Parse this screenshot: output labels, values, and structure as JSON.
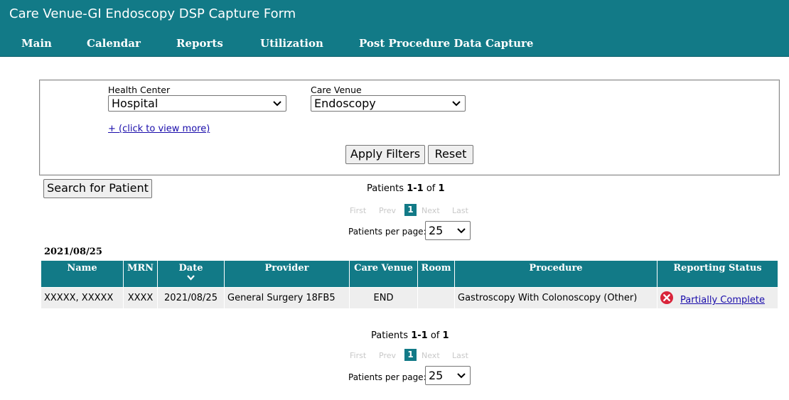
{
  "app": {
    "title": "Care Venue-GI Endoscopy DSP Capture Form"
  },
  "nav": [
    "Main",
    "Calendar",
    "Reports",
    "Utilization",
    "Post Procedure Data Capture"
  ],
  "filters": {
    "health_center_label": "Health Center",
    "health_center_value": "Hospital",
    "care_venue_label": "Care Venue",
    "care_venue_value": "Endoscopy",
    "view_more": "+ (click to view more)",
    "apply_label": "Apply Filters",
    "reset_label": "Reset"
  },
  "search_button": "Search for Patient",
  "pager": {
    "prefix": "Patients",
    "range": "1-1",
    "of": "of",
    "total": "1",
    "first": "First",
    "prev": "Prev",
    "current": "1",
    "next": "Next",
    "last": "Last",
    "per_page_label": "Patients per page:",
    "per_page": "25"
  },
  "group_date": "2021/08/25",
  "table": {
    "headers": [
      "Name",
      "MRN",
      "Date",
      "Provider",
      "Care Venue",
      "Room",
      "Procedure",
      "Reporting Status"
    ],
    "rows": [
      {
        "name": "XXXXX, XXXXX",
        "mrn": "XXXX",
        "date": "2021/08/25",
        "provider": "General Surgery 18FB5",
        "care_venue": "END",
        "room": "",
        "procedure": "Gastroscopy With Colonoscopy (Other)",
        "status": "Partially Complete"
      }
    ]
  },
  "colors": {
    "header_bg": "#127a87",
    "status_error": "#d9243a",
    "link": "#1a0dab"
  },
  "icons": {
    "status": "error-x-circle-icon",
    "sort": "chevron-down-icon",
    "select": "chevron-down-icon"
  }
}
